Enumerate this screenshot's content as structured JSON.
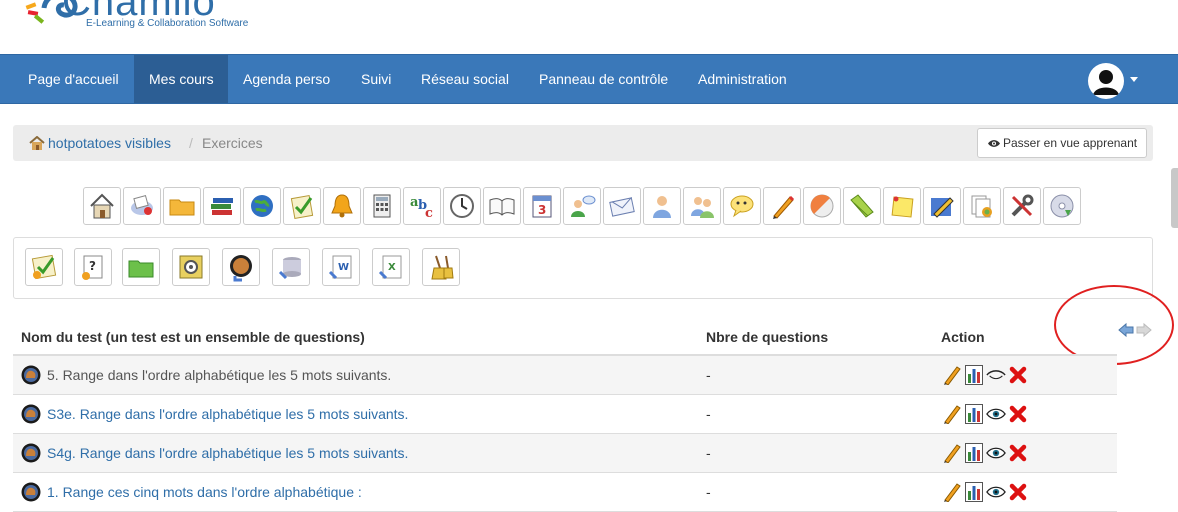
{
  "app": {
    "logo_text": "Chamilo",
    "logo_tagline": "E-Learning & Collaboration Software"
  },
  "nav": {
    "items": [
      {
        "label": "Page d'accueil",
        "active": false
      },
      {
        "label": "Mes cours",
        "active": true
      },
      {
        "label": "Agenda perso",
        "active": false
      },
      {
        "label": "Suivi",
        "active": false
      },
      {
        "label": "Réseau social",
        "active": false
      },
      {
        "label": "Panneau de contrôle",
        "active": false
      },
      {
        "label": "Administration",
        "active": false
      }
    ],
    "user_icon": "user-avatar-icon"
  },
  "breadcrumb": {
    "course": "hotpotatoes visibles",
    "separator": "/",
    "current": "Exercices",
    "student_view_button": "Passer en vue apprenant"
  },
  "course_tools": [
    "home-icon",
    "description-icon",
    "documents-icon",
    "learning-path-icon",
    "links-icon",
    "exercises-icon",
    "announcements-icon",
    "gradebook-icon",
    "glossary-icon",
    "attendance-icon",
    "course-progress-icon",
    "agenda-icon",
    "forum-icon",
    "messages-icon",
    "user-icon",
    "groups-icon",
    "chat-icon",
    "assignments-icon",
    "survey-icon",
    "wiki-icon",
    "notebook-icon",
    "projects-icon",
    "reports-icon",
    "settings-icon",
    "backup-icon"
  ],
  "exercise_actions": [
    "new-exercise-icon",
    "new-question-icon",
    "new-category-icon",
    "question-pool-icon",
    "hotpotatoes-import-icon",
    "import-qti-icon",
    "import-word-icon",
    "import-excel-icon",
    "clean-results-icon"
  ],
  "table": {
    "headers": {
      "name": "Nom du test (un test est un ensemble de questions)",
      "questions": "Nbre de questions",
      "action": "Action"
    },
    "rows": [
      {
        "title": "5. Range dans l'ordre alphabétique les 5 mots suivants.",
        "questions": "-",
        "visible": false
      },
      {
        "title": "S3e. Range dans l'ordre alphabétique les 5 mots suivants.",
        "questions": "-",
        "visible": true
      },
      {
        "title": "S4g. Range dans l'ordre alphabétique les 5 mots suivants.",
        "questions": "-",
        "visible": true
      },
      {
        "title": "1. Range ces cinq mots dans l'ordre alphabétique :",
        "questions": "-",
        "visible": true
      }
    ]
  },
  "colors": {
    "navbar": "#3a78b9",
    "navbar_active": "#2c5e94",
    "link": "#2f6ea8",
    "annotation": "#e02020"
  }
}
